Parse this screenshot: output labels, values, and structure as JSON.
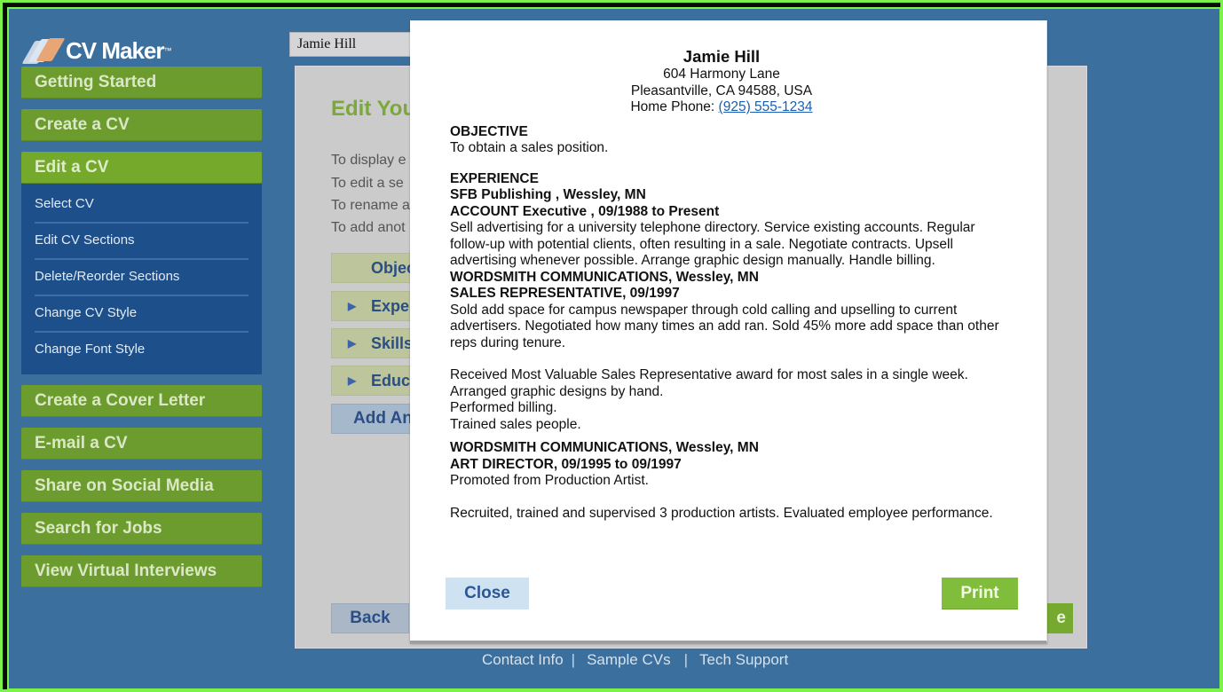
{
  "app": {
    "logo_text": "CV Maker",
    "logo_tm": "™"
  },
  "sidebar": {
    "items": [
      {
        "label": "Getting Started"
      },
      {
        "label": "Create a CV"
      },
      {
        "label": "Edit a CV",
        "active": true
      },
      {
        "label": "Create a Cover Letter"
      },
      {
        "label": "E-mail a CV"
      },
      {
        "label": "Share on Social Media"
      },
      {
        "label": "Search for Jobs"
      },
      {
        "label": "View Virtual Interviews"
      }
    ],
    "edit_subitems": [
      {
        "label": "Select CV"
      },
      {
        "label": "Edit CV Sections"
      },
      {
        "label": "Delete/Reorder Sections"
      },
      {
        "label": "Change CV Style"
      },
      {
        "label": "Change Font Style"
      }
    ]
  },
  "name_field": {
    "value": "Jamie Hill"
  },
  "main": {
    "title": "Edit You",
    "instructions": [
      "To display e",
      "To edit a se",
      "To rename a",
      "To add anot"
    ],
    "sections": [
      {
        "label": "Objec",
        "expandable": false
      },
      {
        "label": "Exper",
        "expandable": true
      },
      {
        "label": "Skills",
        "expandable": true
      },
      {
        "label": "Educ",
        "expandable": true
      }
    ],
    "add_label": "Add An",
    "back_label": "Back",
    "next_label": "e"
  },
  "modal": {
    "cv": {
      "name": "Jamie Hill",
      "address1": "604 Harmony Lane",
      "address2": "Pleasantville, CA 94588, USA",
      "phone_label": "Home Phone: ",
      "phone": "(925) 555-1234",
      "objective_heading": "OBJECTIVE",
      "objective_text": "To obtain a sales position.",
      "experience_heading": "EXPERIENCE",
      "jobs": [
        {
          "employer": "SFB Publishing , Wessley, MN",
          "title": "ACCOUNT Executive , 09/1988 to Present",
          "desc": "Sell advertising for a university telephone directory. Service existing accounts. Regular follow-up with potential clients, often resulting in a sale. Negotiate contracts. Upsell advertising whenever possible. Arrange graphic design manually. Handle billing."
        },
        {
          "employer": "WORDSMITH COMMUNICATIONS, Wessley, MN",
          "title": "SALES REPRESENTATIVE, 09/1997",
          "desc": "Sold add space for campus newspaper through cold calling and upselling to current advertisers. Negotiated how many times an add ran. Sold 45% more add space than other reps during tenure.",
          "extra": [
            "Received Most Valuable Sales Representative award for most sales in a single week.",
            "Arranged graphic designs by hand.",
            "Performed billing.",
            "Trained sales people."
          ]
        },
        {
          "employer": "WORDSMITH COMMUNICATIONS, Wessley, MN",
          "title": "ART DIRECTOR, 09/1995 to 09/1997",
          "desc": "Promoted from Production Artist.",
          "extra": [
            "Recruited, trained and supervised 3 production artists. Evaluated employee performance."
          ]
        }
      ]
    },
    "close_label": "Close",
    "print_label": "Print"
  },
  "footer": {
    "links": [
      "Contact Info",
      "Sample CVs",
      "Tech Support"
    ],
    "separator": "|"
  },
  "colors": {
    "background": "#3b6f9e",
    "nav_green": "#6c9c2e",
    "subnav_blue": "#1d4f8b",
    "print_green": "#80bd3b",
    "close_blue": "#cfe2f2",
    "title_green": "#7aa83a",
    "frame_green": "#7cf34a"
  }
}
